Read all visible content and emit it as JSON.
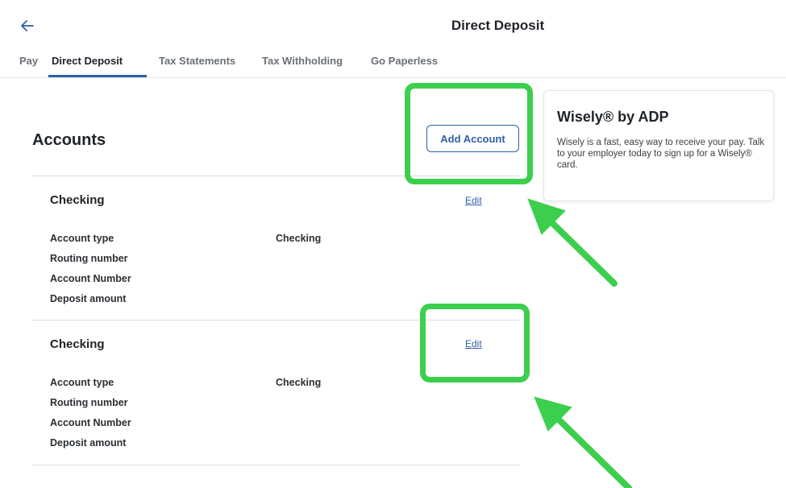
{
  "header": {
    "title": "Direct Deposit",
    "back_icon": "arrow-left-icon"
  },
  "tabs": [
    {
      "label": "Pay",
      "active": false
    },
    {
      "label": "Direct Deposit",
      "active": true
    },
    {
      "label": "Tax Statements",
      "active": false
    },
    {
      "label": "Tax Withholding",
      "active": false
    },
    {
      "label": "Go Paperless",
      "active": false
    }
  ],
  "accounts": {
    "title": "Accounts",
    "add_button": "Add Account",
    "items": [
      {
        "name": "Checking",
        "edit_label": "Edit",
        "fields": [
          "Account type",
          "Routing number",
          "Account Number",
          "Deposit amount"
        ],
        "account_type_value": "Checking"
      },
      {
        "name": "Checking",
        "edit_label": "Edit",
        "fields": [
          "Account type",
          "Routing number",
          "Account Number",
          "Deposit amount"
        ],
        "account_type_value": "Checking"
      }
    ]
  },
  "promo": {
    "title": "Wisely® by ADP",
    "body": "Wisely is a fast, easy way to receive your pay. Talk to your employer today to sign up for a Wisely® card."
  },
  "colors": {
    "accent": "#2e5fa6",
    "highlight": "#3ccf4e"
  }
}
